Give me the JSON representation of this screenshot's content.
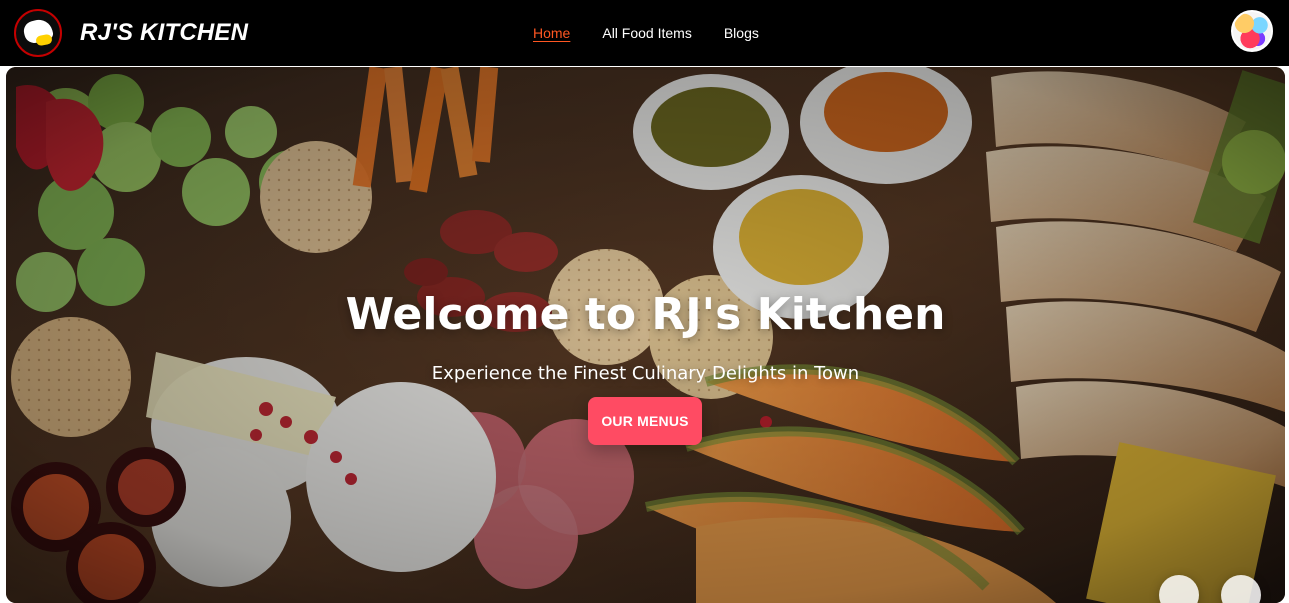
{
  "nav": {
    "brand": "RJ'S KITCHEN",
    "links": [
      {
        "label": "Home",
        "active": true
      },
      {
        "label": "All Food Items",
        "active": false
      },
      {
        "label": "Blogs",
        "active": false
      }
    ]
  },
  "hero": {
    "title": "Welcome to RJ's Kitchen",
    "subtitle": "Experience the Finest Culinary Delights in Town",
    "cta_label": "OUR MENUS"
  },
  "colors": {
    "navbar_bg": "#000000",
    "active_link": "#ff5722",
    "cta_bg": "#ff4b63"
  }
}
